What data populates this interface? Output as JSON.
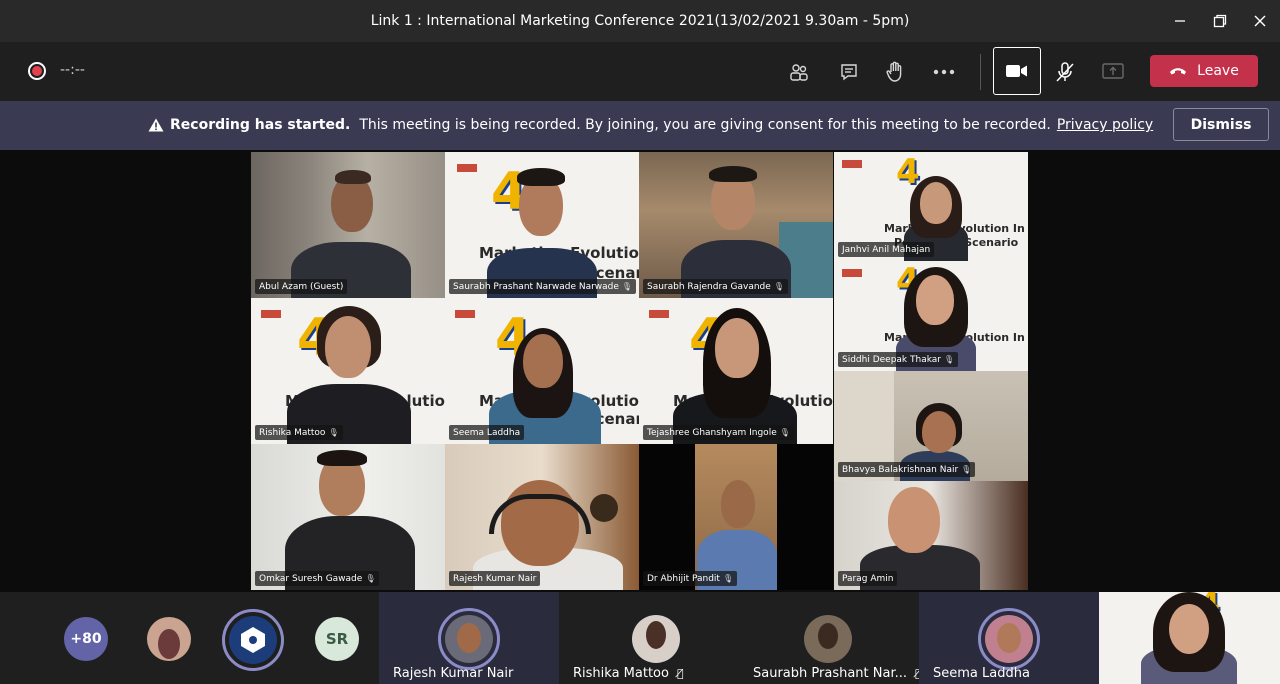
{
  "window": {
    "title": "Link 1 : International Marketing Conference 2021(13/02/2021 9.30am - 5pm)",
    "controls": [
      "minimize-icon",
      "restore-icon",
      "close-icon"
    ]
  },
  "toolbar": {
    "timer": "--:--",
    "leave_label": "Leave",
    "accent": "#c4314b",
    "buttons": [
      "participants-icon",
      "chat-icon",
      "raise-hand-icon",
      "more-icon",
      "camera-icon",
      "mic-off-icon",
      "share-icon"
    ]
  },
  "banner": {
    "strong": "Recording has started.",
    "message": "This meeting is being recorded. By joining, you are giving consent for this meeting to be recorded.",
    "link": "Privacy policy",
    "dismiss_label": "Dismiss"
  },
  "poster": {
    "number": "4",
    "line1": "Marketing Evolution In",
    "line2": "Post-Covid Scenario",
    "head1": "INTERNATIONAL",
    "head2": "MARKETING",
    "head3": "CONFERENCE"
  },
  "participants": [
    {
      "name": "Abul Azam (Guest)"
    },
    {
      "name": "Saurabh Prashant Narwade Narwade"
    },
    {
      "name": "Saurabh Rajendra Gavande"
    },
    {
      "name": "Janhvi Anil Mahajan"
    },
    {
      "name": "Siddhi Deepak Thakar"
    },
    {
      "name": "Rishika  Mattoo"
    },
    {
      "name": "Seema Laddha"
    },
    {
      "name": "Tejashree Ghanshyam Ingole"
    },
    {
      "name": "Bhavya Balakrishnan Nair"
    },
    {
      "name": "Omkar Suresh Gawade"
    },
    {
      "name": "Rajesh Kumar Nair"
    },
    {
      "name": "Dr Abhijit Pandit"
    },
    {
      "name": "Parag Amin"
    }
  ],
  "roster": {
    "overflow": "+80",
    "initials": "SR",
    "cells": [
      {
        "name": "Rajesh Kumar Nair"
      },
      {
        "name": "Rishika Mattoo"
      },
      {
        "name": "Saurabh Prashant Nar..."
      },
      {
        "name": "Seema Laddha"
      }
    ]
  }
}
